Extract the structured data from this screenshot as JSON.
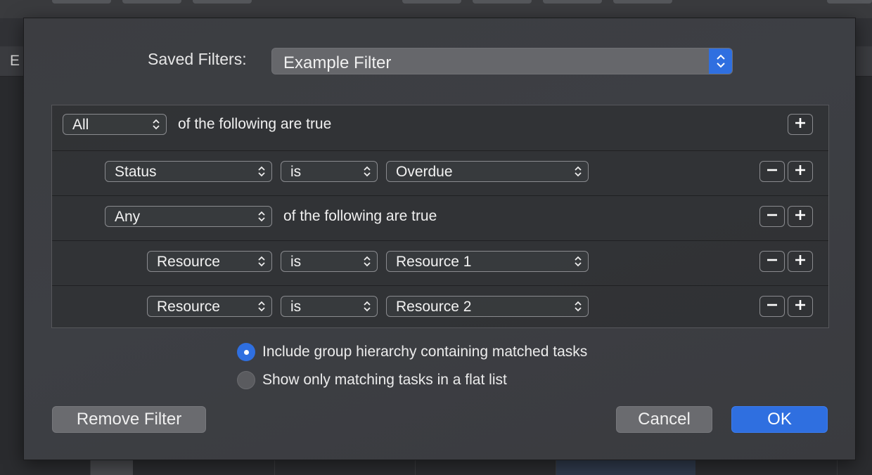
{
  "background": {
    "cut_off_text": "E"
  },
  "saved_filters": {
    "label": "Saved Filters:",
    "value": "Example Filter"
  },
  "rules": [
    {
      "kind": "group",
      "quantifier": "All",
      "text": "of the following are true",
      "has_remove": false
    },
    {
      "kind": "condition",
      "field": "Status",
      "operator": "is",
      "value": "Overdue",
      "has_remove": true
    },
    {
      "kind": "group",
      "quantifier": "Any",
      "text": "of the following are true",
      "has_remove": true
    },
    {
      "kind": "condition",
      "field": "Resource",
      "operator": "is",
      "value": "Resource 1",
      "has_remove": true
    },
    {
      "kind": "condition",
      "field": "Resource",
      "operator": "is",
      "value": "Resource 2",
      "has_remove": true
    }
  ],
  "options": [
    {
      "label": "Include group hierarchy containing matched tasks",
      "selected": true
    },
    {
      "label": "Show only matching tasks in a flat list",
      "selected": false
    }
  ],
  "buttons": {
    "remove_filter": "Remove Filter",
    "cancel": "Cancel",
    "ok": "OK"
  },
  "colors": {
    "accent": "#2f6fe0",
    "sheet_bg": "#3c3d41",
    "control_gray": "#6a6b6f"
  }
}
